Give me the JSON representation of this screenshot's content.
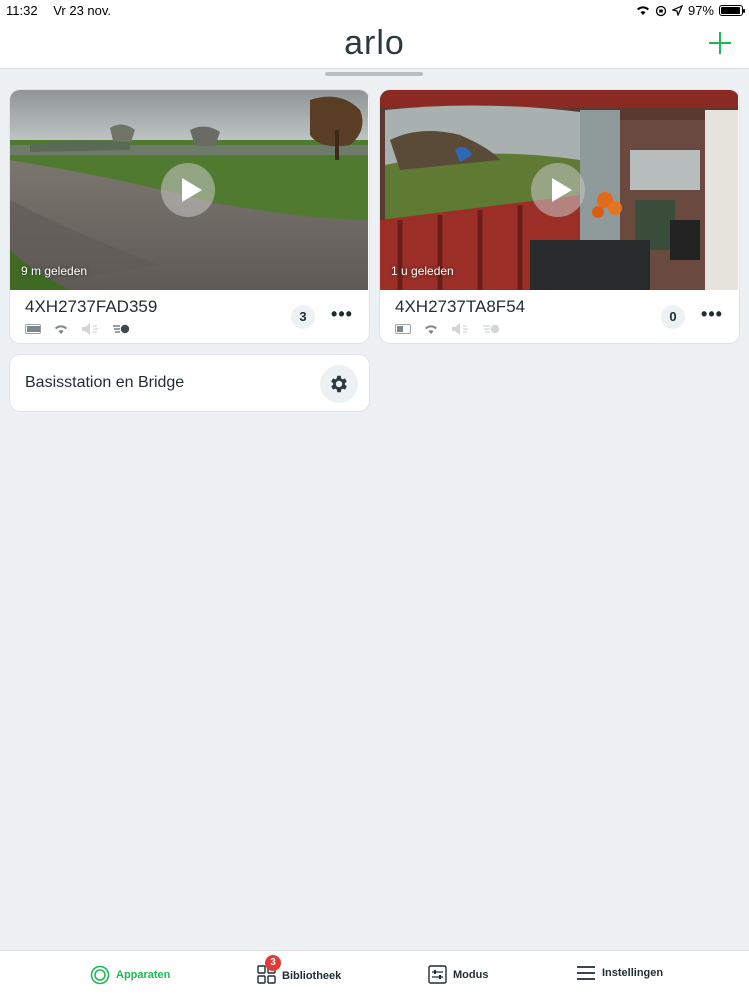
{
  "status_bar": {
    "time": "11:32",
    "date": "Vr 23 nov.",
    "battery": "97%",
    "battery_level": 0.97
  },
  "header": {
    "logo": "arlo",
    "add_icon": "plus-icon"
  },
  "cameras": [
    {
      "thumb_time": "9 m geleden",
      "name": "4XH2737FAD359",
      "count": "3",
      "battery_level": 0.9
    },
    {
      "thumb_time": "1 u geleden",
      "name": "4XH2737TA8F54",
      "count": "0",
      "battery_level": 0.4
    }
  ],
  "base_station": {
    "label": "Basisstation en Bridge",
    "icon": "gear-icon"
  },
  "tabs": [
    {
      "label": "Apparaten",
      "icon": "apparaten-icon",
      "active": true
    },
    {
      "label": "Bibliotheek",
      "icon": "grid-icon",
      "badge": "3"
    },
    {
      "label": "Modus",
      "icon": "sliders-icon"
    },
    {
      "label": "Instellingen",
      "icon": "menu-icon"
    }
  ],
  "colors": {
    "accent": "#1db954",
    "badge": "#e53935",
    "background": "#eef1f4"
  }
}
